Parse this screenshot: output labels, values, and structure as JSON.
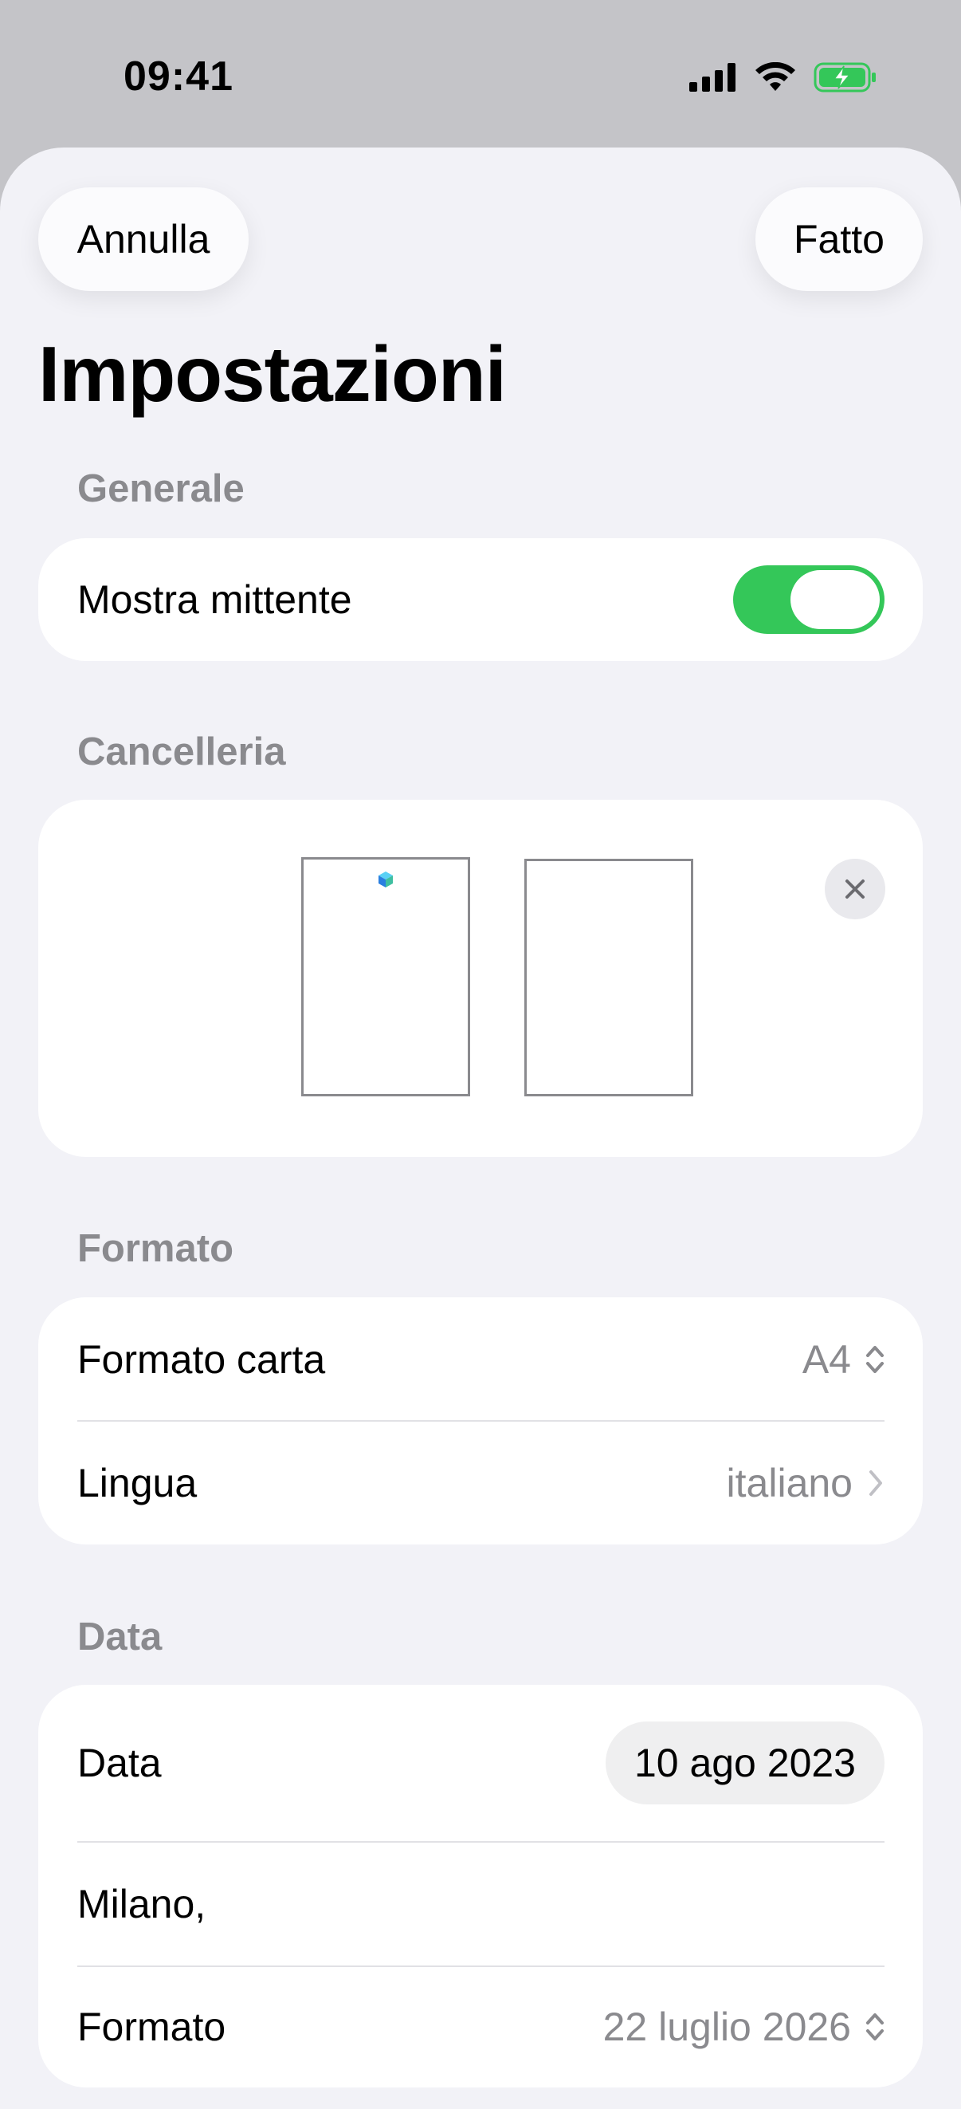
{
  "status_bar": {
    "time": "09:41",
    "icons": [
      "signal-icon",
      "wifi-icon",
      "battery-charging-icon"
    ]
  },
  "nav": {
    "cancel_label": "Annulla",
    "done_label": "Fatto",
    "title": "Impostazioni"
  },
  "sections": {
    "general": {
      "header": "Generale",
      "show_sender_label": "Mostra mittente",
      "show_sender_on": true
    },
    "stationery": {
      "header": "Cancelleria"
    },
    "format": {
      "header": "Formato",
      "paper_label": "Formato carta",
      "paper_value": "A4",
      "language_label": "Lingua",
      "language_value": "italiano"
    },
    "date": {
      "header": "Data",
      "date_label": "Data",
      "date_value": "10 ago 2023",
      "place_value": "Milano,",
      "format_label": "Formato",
      "format_value": "22 luglio 2026"
    }
  },
  "colors": {
    "accent_green": "#34c759",
    "background": "#f2f2f7",
    "secondary_text": "#8a8a8e"
  }
}
